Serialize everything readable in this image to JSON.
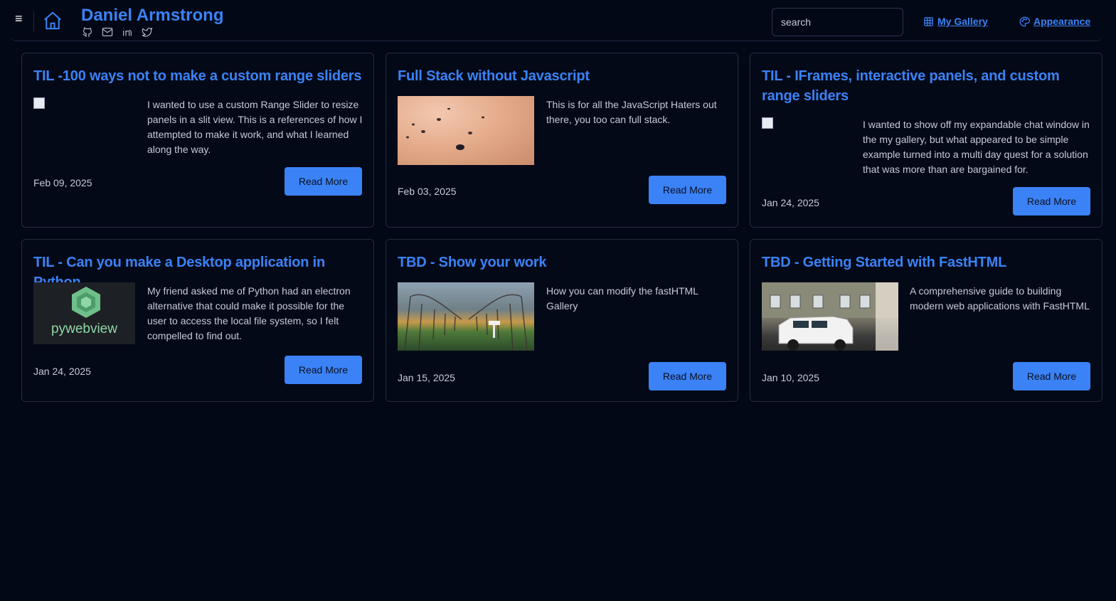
{
  "header": {
    "menu_icon": "hamburger-icon",
    "home_icon": "home-icon",
    "site_title": "Daniel Armstrong",
    "socials": [
      "github-icon",
      "mail-icon",
      "linkedin-icon",
      "twitter-icon"
    ],
    "search_placeholder": "search",
    "nav": [
      {
        "label": "My Gallery",
        "icon": "grid-icon"
      },
      {
        "label": "Appearance",
        "icon": "palette-icon"
      }
    ],
    "accent_color": "#3b82f6"
  },
  "cards": [
    {
      "title": "TIL -100 ways not to make a custom range sliders",
      "image": "broken-image",
      "description": "I wanted to use a custom Range Slider to resize panels in a slit view. This is a references of how I attempted to make it work, and what I learned along the way.",
      "date": "Feb 09, 2025",
      "button": "Read More"
    },
    {
      "title": "Full Stack without Javascript",
      "image": "sand-stones-photo",
      "description": "This is for all the JavaScript Haters out there, you too can full stack.",
      "date": "Feb 03, 2025",
      "button": "Read More"
    },
    {
      "title": "TIL - IFrames, interactive panels, and custom range sliders",
      "image": "broken-image",
      "description": "I wanted to show off my expandable chat window in the my gallery, but what appeared to be simple example turned into a multi day quest for a solution that was more than are bargained for.",
      "date": "Jan 24, 2025",
      "button": "Read More"
    },
    {
      "title": "TIL - Can you make a Desktop application in Python",
      "image": "pywebview-logo",
      "image_text": "pywebview",
      "description": "My friend asked me of Python had an electron alternative that could make it possible for the user to access the local file system, so I felt compelled to find out.",
      "date": "Jan 24, 2025",
      "button": "Read More"
    },
    {
      "title": "TBD - Show your work",
      "image": "orchard-path-photo",
      "description": "How you can modify the fastHTML Gallery",
      "date": "Jan 15, 2025",
      "button": "Read More"
    },
    {
      "title": "TBD - Getting Started with FastHTML",
      "image": "white-jeep-photo",
      "description": "A comprehensive guide to building modern web applications with FastHTML",
      "date": "Jan 10, 2025",
      "button": "Read More"
    }
  ]
}
